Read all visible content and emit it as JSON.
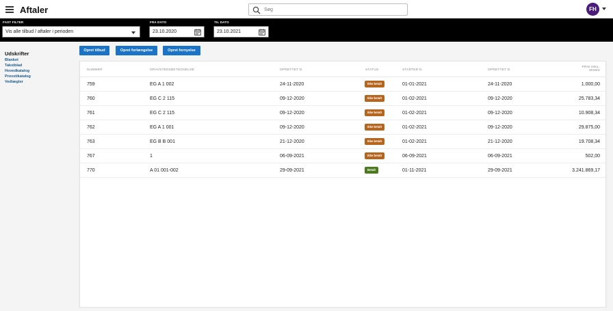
{
  "header": {
    "title": "Aftaler",
    "search_placeholder": "Søg",
    "avatar_initials": "FH"
  },
  "filters": {
    "fast_filter_label": "FAST FILTER",
    "fast_filter_value": "Vis alle tilbud / aftaler i perioden",
    "fra_dato_label": "FRA DATO",
    "fra_dato_value": "23.10.2020",
    "til_dato_label": "TIL DATO",
    "til_dato_value": "23.10.2021"
  },
  "sidebar": {
    "title": "Udskrifter",
    "items": [
      "Blanket",
      "Takstblad",
      "Hovedkatalog",
      "Provstikatalog",
      "Vedtægter"
    ]
  },
  "actions": {
    "opret_tilbud": "Opret tilbud",
    "opret_forlaengelse": "Opret forlængelse",
    "opret_fornyelse": "Opret fornyelse"
  },
  "table": {
    "columns": {
      "nummer": "NUMMER",
      "gravsted": "GRAVSTEDSBETEGNELSE",
      "oprettet": "OPRETTET D.",
      "status": "STATUS",
      "starter": "STARTER D.",
      "oprettet2": "OPRETTET D.",
      "pris_line1": "PRIS INKL.",
      "pris_line2": "MOMS"
    },
    "rows": [
      {
        "nummer": "759",
        "gravsted": "EG A 1 002",
        "oprettet": "24-11-2020",
        "status": "Ikke betalt",
        "starter": "01-01-2021",
        "oprettet2": "24-11-2020",
        "pris": "1.000,00"
      },
      {
        "nummer": "760",
        "gravsted": "EG C 2 115",
        "oprettet": "09-12-2020",
        "status": "Ikke betalt",
        "starter": "01-02-2021",
        "oprettet2": "09-12-2020",
        "pris": "25.783,34"
      },
      {
        "nummer": "761",
        "gravsted": "EG C 2 115",
        "oprettet": "09-12-2020",
        "status": "Ikke betalt",
        "starter": "01-02-2021",
        "oprettet2": "09-12-2020",
        "pris": "10.908,34"
      },
      {
        "nummer": "762",
        "gravsted": "EG A 1 001",
        "oprettet": "09-12-2020",
        "status": "Ikke betalt",
        "starter": "01-02-2021",
        "oprettet2": "09-12-2020",
        "pris": "29.875,00"
      },
      {
        "nummer": "763",
        "gravsted": "EG B B 001",
        "oprettet": "21-12-2020",
        "status": "Ikke betalt",
        "starter": "01-02-2021",
        "oprettet2": "21-12-2020",
        "pris": "19.708,34"
      },
      {
        "nummer": "767",
        "gravsted": "1",
        "oprettet": "06-09-2021",
        "status": "Ikke betalt",
        "starter": "06-09-2021",
        "oprettet2": "06-09-2021",
        "pris": "502,00"
      },
      {
        "nummer": "770",
        "gravsted": "A 01 001-002",
        "oprettet": "29-09-2021",
        "status": "Betalt",
        "starter": "01-11-2021",
        "oprettet2": "29-09-2021",
        "pris": "3.241.869,17"
      }
    ]
  },
  "colors": {
    "accent": "#1a73c6",
    "unpaid": "#b5651d",
    "paid": "#4c7a1f",
    "avatar": "#4a1d7a"
  }
}
